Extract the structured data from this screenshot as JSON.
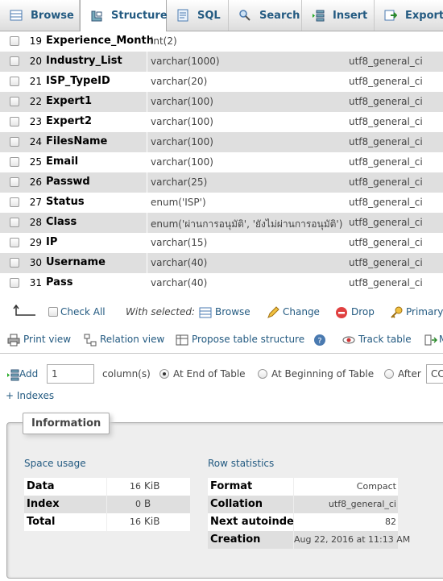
{
  "tabs": [
    {
      "label": "Browse",
      "icon": "browse-icon"
    },
    {
      "label": "Structure",
      "icon": "structure-icon"
    },
    {
      "label": "SQL",
      "icon": "sql-icon"
    },
    {
      "label": "Search",
      "icon": "search-icon"
    },
    {
      "label": "Insert",
      "icon": "insert-icon"
    },
    {
      "label": "Export",
      "icon": "export-icon"
    }
  ],
  "columns": [
    {
      "num": "19",
      "name": "Experience_Month",
      "type": "int(2)",
      "collation": ""
    },
    {
      "num": "20",
      "name": "Industry_List",
      "type": "varchar(1000)",
      "collation": "utf8_general_ci"
    },
    {
      "num": "21",
      "name": "ISP_TypeID",
      "type": "varchar(20)",
      "collation": "utf8_general_ci"
    },
    {
      "num": "22",
      "name": "Expert1",
      "type": "varchar(100)",
      "collation": "utf8_general_ci"
    },
    {
      "num": "23",
      "name": "Expert2",
      "type": "varchar(100)",
      "collation": "utf8_general_ci"
    },
    {
      "num": "24",
      "name": "FilesName",
      "type": "varchar(100)",
      "collation": "utf8_general_ci"
    },
    {
      "num": "25",
      "name": "Email",
      "type": "varchar(100)",
      "collation": "utf8_general_ci"
    },
    {
      "num": "26",
      "name": "Passwd",
      "type": "varchar(25)",
      "collation": "utf8_general_ci"
    },
    {
      "num": "27",
      "name": "Status",
      "type": "enum('ISP')",
      "collation": "utf8_general_ci"
    },
    {
      "num": "28",
      "name": "Class",
      "type": "enum('ผ่านการอนุมัติ', 'ยังไม่ผ่านการอนุมัติ')",
      "collation": "utf8_general_ci"
    },
    {
      "num": "29",
      "name": "IP",
      "type": "varchar(15)",
      "collation": "utf8_general_ci"
    },
    {
      "num": "30",
      "name": "Username",
      "type": "varchar(40)",
      "collation": "utf8_general_ci"
    },
    {
      "num": "31",
      "name": "Pass",
      "type": "varchar(40)",
      "collation": "utf8_general_ci"
    }
  ],
  "bulk": {
    "check_all": "Check All",
    "with_selected": "With selected:",
    "browse": "Browse",
    "change": "Change",
    "drop": "Drop",
    "primary": "Primary"
  },
  "links": {
    "print_view": "Print view",
    "relation_view": "Relation view",
    "propose": "Propose table structure",
    "track": "Track table",
    "move_partial": "M"
  },
  "add_column": {
    "add_label": "Add",
    "count_value": "1",
    "columns_label": "column(s)",
    "at_end": "At End of Table",
    "at_beginning": "At Beginning of Table",
    "after": "After",
    "after_value": "CC"
  },
  "indexes_link": "+ Indexes",
  "information": {
    "legend": "Information",
    "space_usage": {
      "title": "Space usage",
      "rows": [
        {
          "label": "Data",
          "value": "16",
          "unit": "KiB"
        },
        {
          "label": "Index",
          "value": "0",
          "unit": "B"
        },
        {
          "label": "Total",
          "value": "16",
          "unit": "KiB"
        }
      ]
    },
    "row_statistics": {
      "title": "Row statistics",
      "rows": [
        {
          "label": "Format",
          "value": "Compact"
        },
        {
          "label": "Collation",
          "value": "utf8_general_ci"
        },
        {
          "label": "Next autoindex",
          "value": "82"
        },
        {
          "label": "Creation",
          "value": "Aug 22, 2016 at 11:13 AM"
        }
      ]
    }
  },
  "colors": {
    "link": "#235a81",
    "row_alt": "#dfdfdf",
    "drop_red": "#d33"
  }
}
